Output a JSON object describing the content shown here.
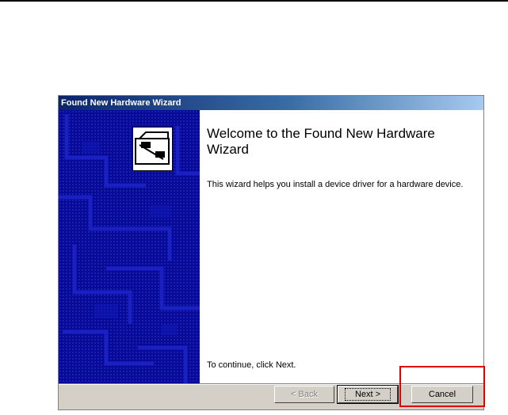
{
  "window": {
    "title": "Found New Hardware Wizard"
  },
  "content": {
    "heading": "Welcome to the Found New Hardware Wizard",
    "description": "This wizard helps you install a device driver for a hardware device.",
    "continue_hint": "To continue, click Next."
  },
  "buttons": {
    "back_label": "< Back",
    "next_label": "Next >",
    "cancel_label": "Cancel"
  },
  "colors": {
    "title_gradient_start": "#0a246a",
    "side_panel": "#08089a",
    "highlight_box": "#e00000",
    "dialog_face": "#d4d0c8"
  },
  "icons": [
    "hardware-device-icon"
  ],
  "annotation": {
    "highlighted_control": "cancel-button"
  }
}
